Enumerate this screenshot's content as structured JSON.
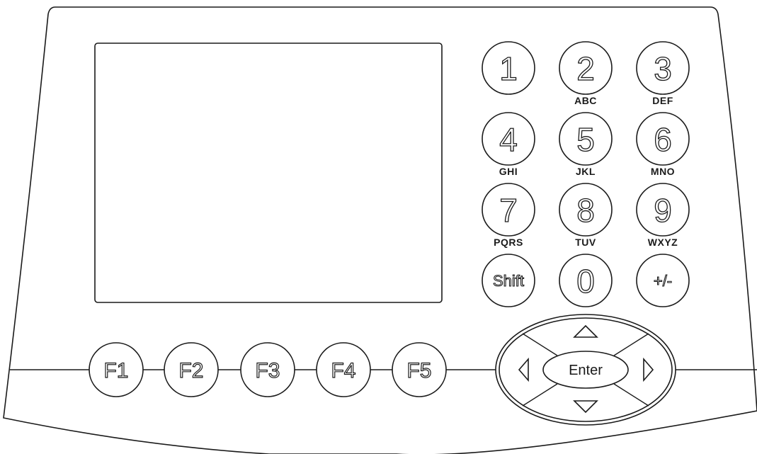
{
  "keypad": {
    "keys": [
      {
        "digit": "1",
        "letters": ""
      },
      {
        "digit": "2",
        "letters": "ABC"
      },
      {
        "digit": "3",
        "letters": "DEF"
      },
      {
        "digit": "4",
        "letters": "GHI"
      },
      {
        "digit": "5",
        "letters": "JKL"
      },
      {
        "digit": "6",
        "letters": "MNO"
      },
      {
        "digit": "7",
        "letters": "PQRS"
      },
      {
        "digit": "8",
        "letters": "TUV"
      },
      {
        "digit": "9",
        "letters": "WXYZ"
      }
    ],
    "shift_label": "Shift",
    "zero_label": "0",
    "sign_label": "+/-"
  },
  "function_keys": [
    "F1",
    "F2",
    "F3",
    "F4",
    "F5"
  ],
  "navigation": {
    "enter_label": "Enter",
    "arrows": [
      "up",
      "down",
      "left",
      "right"
    ]
  },
  "colors": {
    "stroke": "#1a1a1a",
    "fill": "#ffffff"
  }
}
